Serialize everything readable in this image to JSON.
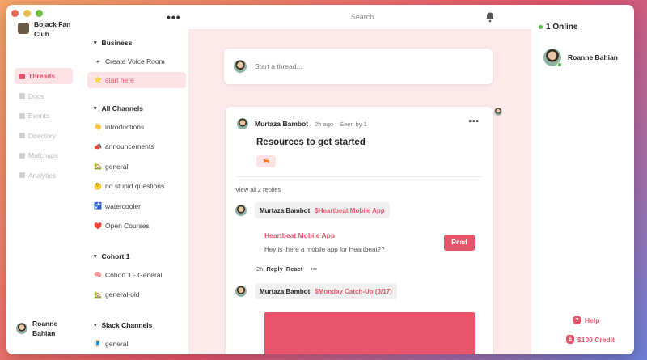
{
  "titlebar": {
    "search_placeholder": "Search"
  },
  "workspace": {
    "name": "Bojack Fan Club"
  },
  "rail": {
    "items": [
      {
        "label": "Threads",
        "icon": "threads-icon"
      },
      {
        "label": "Docs",
        "icon": "docs-icon"
      },
      {
        "label": "Events",
        "icon": "calendar-icon"
      },
      {
        "label": "Directory",
        "icon": "directory-icon"
      },
      {
        "label": "Matchups",
        "icon": "matchups-icon"
      },
      {
        "label": "Analytics",
        "icon": "analytics-icon"
      }
    ],
    "user_name": "Roanne Bahian"
  },
  "channels": {
    "business": {
      "header": "Business",
      "items": [
        {
          "emoji": "+",
          "label": "Create Voice Room"
        },
        {
          "emoji": "⭐",
          "label": "start here"
        }
      ]
    },
    "all_channels": {
      "header": "All Channels",
      "items": [
        {
          "emoji": "👋",
          "label": "introductions"
        },
        {
          "emoji": "📣",
          "label": "announcements"
        },
        {
          "emoji": "🏡",
          "label": "general"
        },
        {
          "emoji": "🤔",
          "label": "no stupid questions"
        },
        {
          "emoji": "🚰",
          "label": "watercooler"
        },
        {
          "emoji": "❤️",
          "label": "Open Courses"
        }
      ]
    },
    "cohort": {
      "header": "Cohort 1",
      "items": [
        {
          "emoji": "🧠",
          "label": "Cohort 1 - General"
        },
        {
          "emoji": "🏡",
          "label": "general-old"
        }
      ]
    },
    "slack": {
      "header": "Slack Channels",
      "items": [
        {
          "emoji": "🧵",
          "label": "general"
        }
      ]
    }
  },
  "composer": {
    "placeholder": "Start a thread..."
  },
  "thread": {
    "author": "Murtaza Bambot",
    "time": "2h ago",
    "seen": "Seen by 1",
    "title": "Resources to get started",
    "reaction": "🦐",
    "view_replies": "View all 2 replies",
    "replies": [
      {
        "author": "Murtaza Bambot",
        "link": "$Heartbeat Mobile App",
        "embed_title": "Heartbeat Mobile App",
        "embed_desc": "Hey is there a mobile app for Heartbeat??",
        "read_label": "Read",
        "actions": {
          "time": "2h",
          "reply": "Reply",
          "react": "React",
          "more": "•••"
        }
      },
      {
        "author": "Murtaza Bambot",
        "link": "$Monday Catch-Up (3/17)"
      }
    ]
  },
  "right_panel": {
    "online_label": "1 Online",
    "member_name": "Roanne Bahian",
    "help_label": "Help",
    "credit_label": "$100 Credit"
  },
  "colors": {
    "accent": "#e8546b",
    "accent_light": "#fde2e6",
    "online": "#55b84a"
  }
}
